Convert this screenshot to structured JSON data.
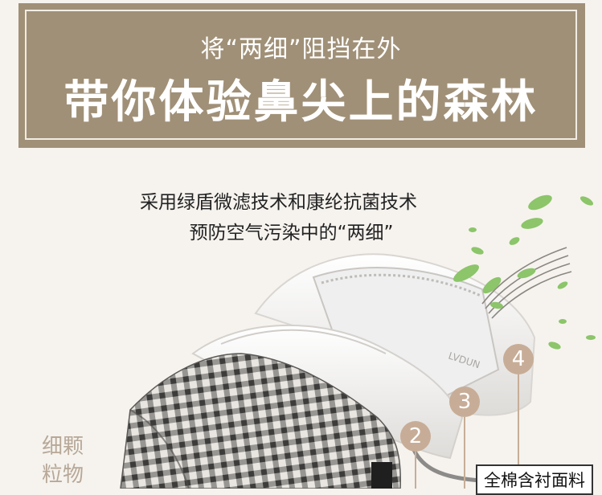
{
  "banner": {
    "subtitle": "将“两细”阻挡在外",
    "title": "带你体验鼻尖上的森林"
  },
  "description": {
    "line1": "采用绿盾微滤技术和康纶抗菌技术",
    "line2": "预防空气污染中的“两细”"
  },
  "mask_print": "LVDUN",
  "side_label": {
    "line1": "细颗",
    "line2": "粒物"
  },
  "markers": [
    "2",
    "3",
    "4"
  ],
  "layer_label": "全棉含衬面料",
  "colors": {
    "banner": "#a09077",
    "background": "#f6f3ee",
    "marker": "#c7ad97",
    "leaf": "#8cc56a"
  }
}
